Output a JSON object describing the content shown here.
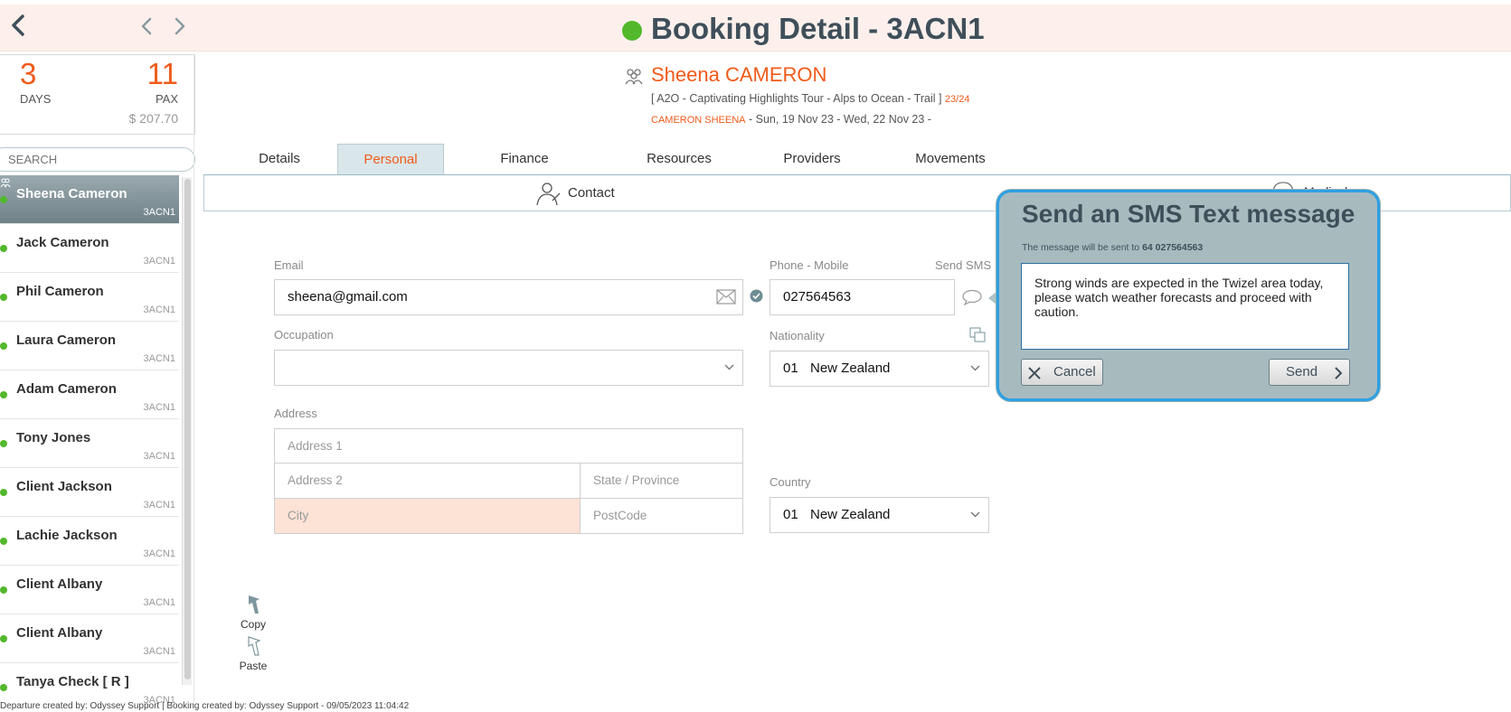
{
  "header": {
    "title": "Booking Detail - 3ACN1",
    "status_color": "#52b82c",
    "back_icon": "chevron-left-icon",
    "prev_icon": "chevron-left-icon",
    "next_icon": "chevron-right-icon"
  },
  "stats": {
    "days": "3",
    "days_label": "DAYS",
    "pax": "11",
    "pax_label": "PAX",
    "total": "$ 207.70"
  },
  "search": {
    "placeholder": "SEARCH"
  },
  "passengers": [
    {
      "name": "Sheena Cameron",
      "code": "3ACN1",
      "active": true
    },
    {
      "name": "Jack Cameron",
      "code": "3ACN1"
    },
    {
      "name": "Phil Cameron",
      "code": "3ACN1"
    },
    {
      "name": "Laura Cameron",
      "code": "3ACN1"
    },
    {
      "name": "Adam Cameron",
      "code": "3ACN1"
    },
    {
      "name": "Tony Jones",
      "code": "3ACN1"
    },
    {
      "name": "Client Jackson",
      "code": "3ACN1"
    },
    {
      "name": "Lachie Jackson",
      "code": "3ACN1"
    },
    {
      "name": "Client Albany",
      "code": "3ACN1"
    },
    {
      "name": "Client Albany",
      "code": "3ACN1"
    },
    {
      "name": "Tanya Check  [ R ]",
      "code": "3ACN1"
    }
  ],
  "client": {
    "name": "Sheena CAMERON",
    "tour": "[ A2O - Captivating Highlights Tour - Alps to Ocean - Trail ]",
    "tour_count": "23/24",
    "ref": "CAMERON SHEENA",
    "dates": " - Sun, 19 Nov 23 - Wed, 22 Nov 23 -"
  },
  "tabs": [
    "Details",
    "Personal",
    "Finance",
    "Resources",
    "Providers",
    "Movements"
  ],
  "active_tab": "Personal",
  "subbar": {
    "contact_label": "Contact",
    "medical_label": "Medical"
  },
  "form": {
    "email_label": "Email",
    "email_value": "sheena@gmail.com",
    "phone_label": "Phone - Mobile",
    "phone_value": "027564563",
    "send_sms_label": "Send SMS",
    "occupation_label": "Occupation",
    "occupation_value": "",
    "nationality_label": "Nationality",
    "nationality_code": "01",
    "nationality_value": "New Zealand",
    "address_label": "Address",
    "address1_placeholder": "Address 1",
    "address2_placeholder": "Address 2",
    "state_placeholder": "State / Province",
    "city_placeholder": "City",
    "postcode_placeholder": "PostCode",
    "country_label": "Country",
    "country_code": "01",
    "country_value": "New Zealand"
  },
  "tools": {
    "copy_label": "Copy",
    "paste_label": "Paste"
  },
  "footer": "Departure created by: Odyssey Support | Booking created by: Odyssey Support - 09/05/2023 11:04:42",
  "sms": {
    "title": "Send an SMS Text message",
    "note_prefix": "The message will be sent to",
    "number": "64 027564563",
    "message": "Strong winds are expected in the Twizel area today, please watch weather forecasts and proceed with caution.",
    "cancel_label": "Cancel",
    "send_label": "Send",
    "border_color": "#2ea0e3"
  },
  "colors": {
    "accent": "#f05a1a",
    "status_green": "#52b82c",
    "header_bg": "#fdf0ec"
  }
}
